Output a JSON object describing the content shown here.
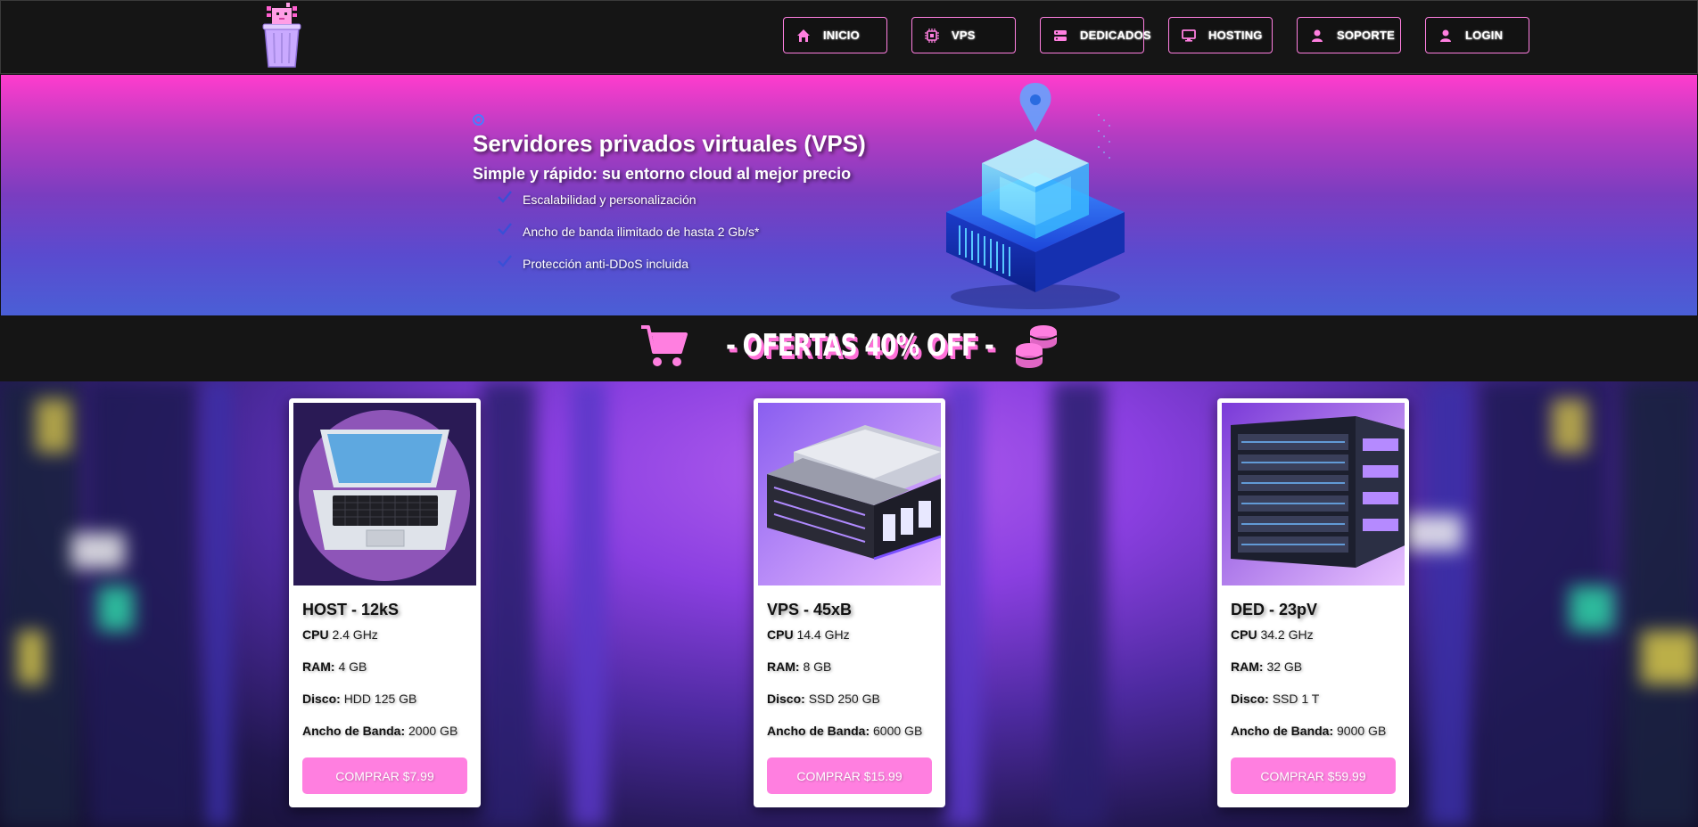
{
  "colors": {
    "accent_pink": "#ff7fe0",
    "bg_dark": "#151515",
    "hero_top": "#ff3ccd",
    "hero_bottom": "#4a5fd6"
  },
  "nav": {
    "items": [
      {
        "label": "INICIO",
        "icon": "home-icon"
      },
      {
        "label": "VPS",
        "icon": "chip-icon"
      },
      {
        "label": "DEDICADOS",
        "icon": "server-icon"
      },
      {
        "label": "HOSTING",
        "icon": "monitor-icon"
      },
      {
        "label": "SOPORTE",
        "icon": "user-icon"
      },
      {
        "label": "LOGIN",
        "icon": "user-icon"
      }
    ]
  },
  "hero": {
    "title": "Servidores privados virtuales (VPS)",
    "subtitle": "Simple y rápido: su entorno cloud al mejor precio",
    "features": [
      "Escalabilidad y personalización",
      "Ancho de banda ilimitado de hasta 2 Gb/s*",
      "Protección anti-DDoS incluida"
    ]
  },
  "offers": {
    "title": "- OFERTAS 40% OFF -"
  },
  "cards": [
    {
      "title": "HOST - 12kS",
      "specs": [
        {
          "label": "CPU",
          "value": "2.4 GHz"
        },
        {
          "label": "RAM:",
          "value": "4 GB"
        },
        {
          "label": "Disco:",
          "value": "HDD 125 GB"
        },
        {
          "label": "Ancho de Banda:",
          "value": "2000 GB"
        }
      ],
      "button": "COMPRAR $7.99"
    },
    {
      "title": "VPS - 45xB",
      "specs": [
        {
          "label": "CPU",
          "value": "14.4 GHz"
        },
        {
          "label": "RAM:",
          "value": "8 GB"
        },
        {
          "label": "Disco:",
          "value": "SSD 250 GB"
        },
        {
          "label": "Ancho de Banda:",
          "value": "6000 GB"
        }
      ],
      "button": "COMPRAR $15.99"
    },
    {
      "title": "DED - 23pV",
      "specs": [
        {
          "label": "CPU",
          "value": "34.2 GHz"
        },
        {
          "label": "RAM:",
          "value": "32 GB"
        },
        {
          "label": "Disco:",
          "value": "SSD 1 T"
        },
        {
          "label": "Ancho de Banda:",
          "value": "9000 GB"
        }
      ],
      "button": "COMPRAR $59.99"
    }
  ]
}
